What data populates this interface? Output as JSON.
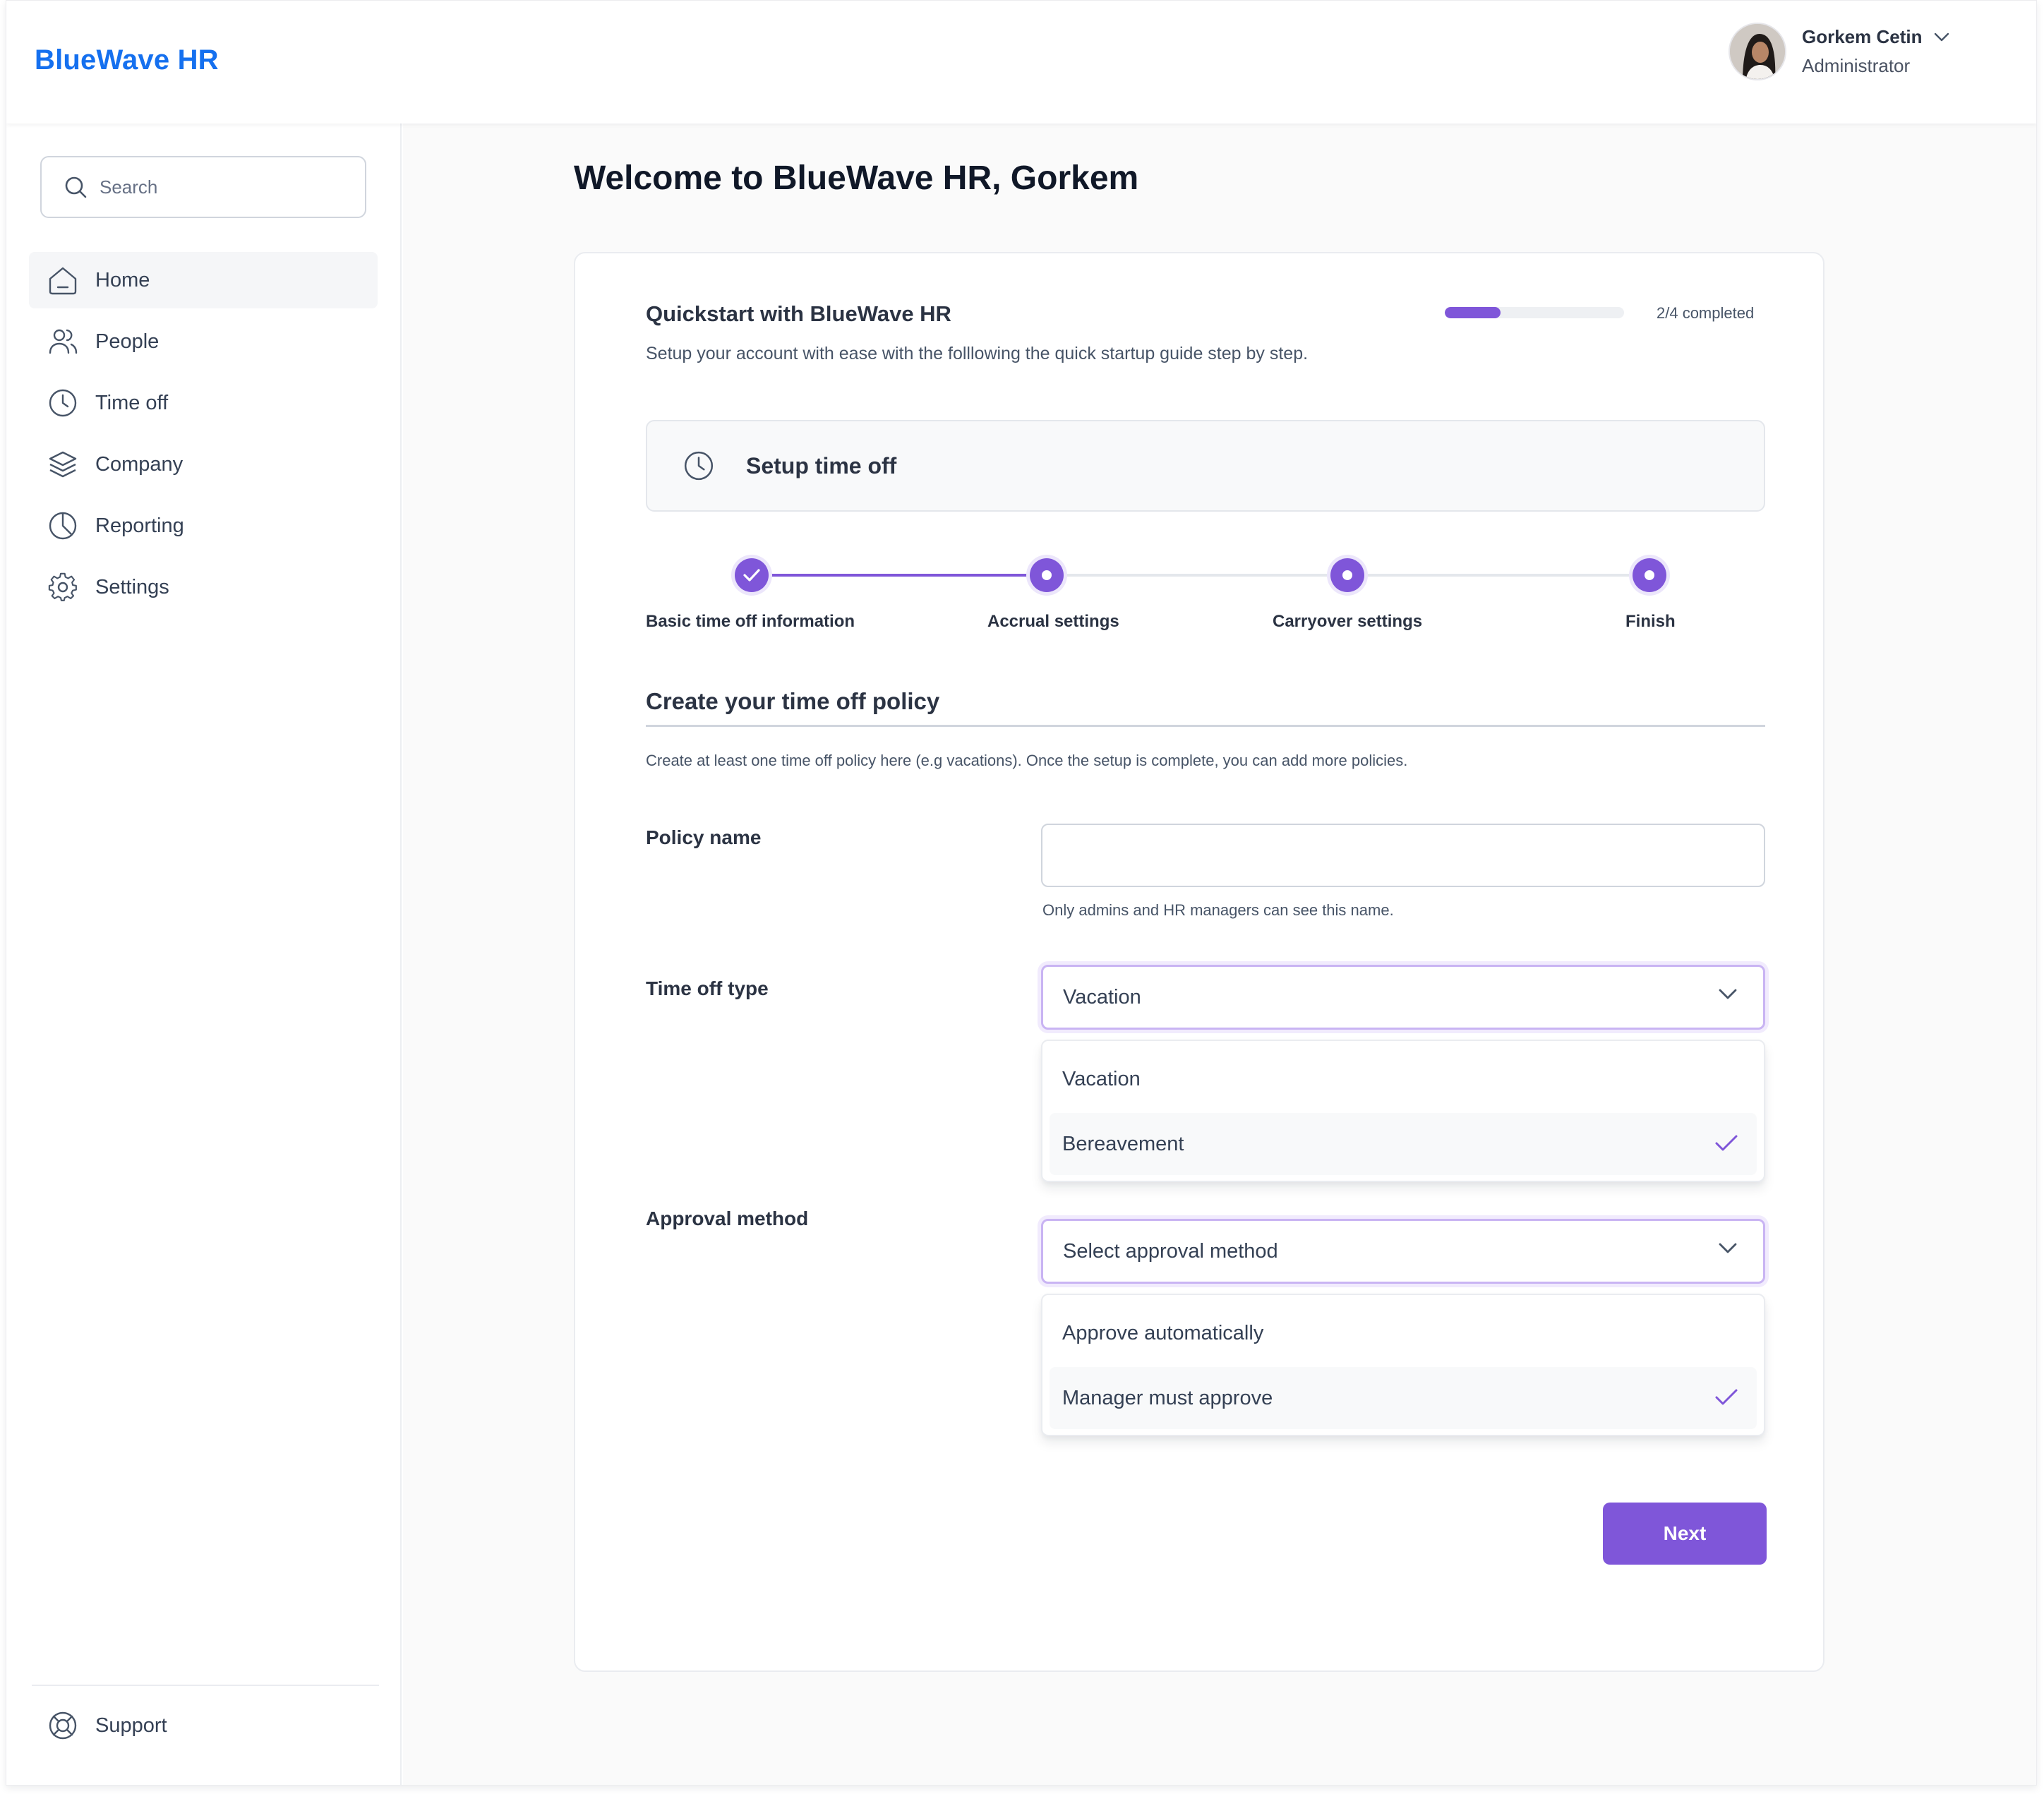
{
  "app": {
    "brand": "BlueWave HR",
    "accent": "#7f56d9",
    "brand_color": "#1570ef"
  },
  "user": {
    "name": "Gorkem Cetin",
    "role": "Administrator"
  },
  "search": {
    "placeholder": "Search"
  },
  "sidebar": {
    "items": [
      {
        "label": "Home",
        "icon": "home-icon",
        "active": true
      },
      {
        "label": "People",
        "icon": "users-icon"
      },
      {
        "label": "Time off",
        "icon": "clock-icon"
      },
      {
        "label": "Company",
        "icon": "layers-icon"
      },
      {
        "label": "Reporting",
        "icon": "pie-chart-icon"
      },
      {
        "label": "Settings",
        "icon": "gear-icon"
      }
    ],
    "support": {
      "label": "Support",
      "icon": "life-buoy-icon"
    }
  },
  "main": {
    "welcome": "Welcome to BlueWave HR, Gorkem",
    "quickstart": {
      "title": "Quickstart with BlueWave HR",
      "subtitle": "Setup your account with ease with the folllowing the quick startup guide step by step.",
      "progress_fraction": 0.31,
      "progress_label": "2/4 completed"
    },
    "setup": {
      "label": "Setup time off",
      "icon": "clock-icon"
    },
    "steps": [
      {
        "label": "Basic time off information",
        "status": "done"
      },
      {
        "label": "Accrual settings",
        "status": "current"
      },
      {
        "label": "Carryover settings",
        "status": "pending"
      },
      {
        "label": "Finish",
        "status": "pending"
      }
    ],
    "policy": {
      "title": "Create your time off policy",
      "description": "Create at least one time off policy here (e.g vacations). Once the setup is complete, you can add more policies.",
      "name_label": "Policy name",
      "name_value": "",
      "name_hint": "Only admins and HR managers can see this name.",
      "type_label": "Time off type",
      "type_value": "Vacation",
      "type_options": [
        "Vacation",
        "Bereavement"
      ],
      "type_checked": "Bereavement",
      "approval_label": "Approval method",
      "approval_placeholder": "Select approval method",
      "approval_options": [
        "Approve automatically",
        "Manager must approve"
      ],
      "approval_checked": "Manager must approve"
    },
    "next_label": "Next"
  }
}
